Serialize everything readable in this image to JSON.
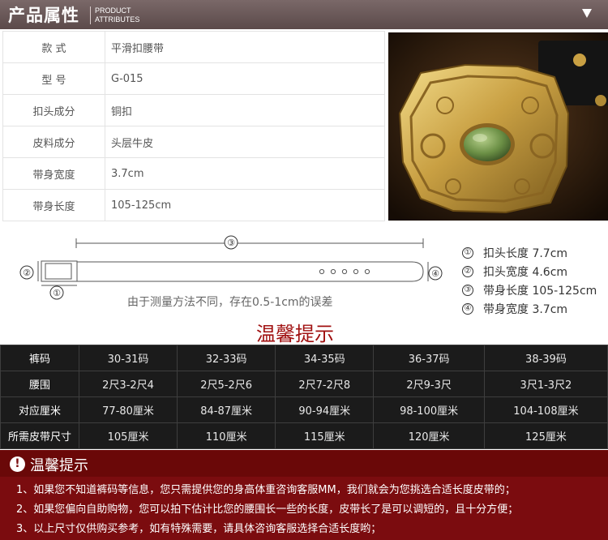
{
  "header": {
    "title": "产品属性",
    "subtitle_line1": "PRODUCT",
    "subtitle_line2": "ATTRIBUTES"
  },
  "attributes": [
    {
      "key": "款 式",
      "value": "平滑扣腰带"
    },
    {
      "key": "型 号",
      "value": "G-015"
    },
    {
      "key": "扣头成分",
      "value": "铜扣"
    },
    {
      "key": "皮料成分",
      "value": "头层牛皮"
    },
    {
      "key": "带身宽度",
      "value": "3.7cm"
    },
    {
      "key": "带身长度",
      "value": "105-125cm"
    }
  ],
  "diagram": {
    "markers": [
      "①",
      "②",
      "③",
      "④"
    ],
    "note": "由于测量方法不同，存在0.5-1cm的误差",
    "dimensions": [
      {
        "num": "①",
        "text": "扣头长度 7.7cm"
      },
      {
        "num": "②",
        "text": "扣头宽度 4.6cm"
      },
      {
        "num": "③",
        "text": "带身长度 105-125cm"
      },
      {
        "num": "④",
        "text": "带身宽度 3.7cm"
      }
    ]
  },
  "warm_title": "温馨提示",
  "size_table": {
    "rows": [
      {
        "label": "裤码",
        "cells": [
          "30-31码",
          "32-33码",
          "34-35码",
          "36-37码",
          "38-39码"
        ]
      },
      {
        "label": "腰围",
        "cells": [
          "2尺3-2尺4",
          "2尺5-2尺6",
          "2尺7-2尺8",
          "2尺9-3尺",
          "3尺1-3尺2"
        ]
      },
      {
        "label": "对应厘米",
        "cells": [
          "77-80厘米",
          "84-87厘米",
          "90-94厘米",
          "98-100厘米",
          "104-108厘米"
        ]
      },
      {
        "label": "所需皮带尺寸",
        "cells": [
          "105厘米",
          "110厘米",
          "115厘米",
          "120厘米",
          "125厘米"
        ]
      }
    ]
  },
  "notice": {
    "icon": "!",
    "title": "温馨提示",
    "items": [
      "1、如果您不知道裤码等信息，您只需提供您的身高体重咨询客服MM，我们就会为您挑选合适长度皮带的；",
      "2、如果您偏向自助购物，您可以拍下估计比您的腰围长一些的长度，皮带长了是可以调短的，且十分方便；",
      "3、以上尺寸仅供购买参考，如有特殊需要，请具体咨询客服选择合适长度哟；"
    ]
  },
  "colors": {
    "header_bg": "#6b5858",
    "warm_red": "#a01010",
    "notice_bg": "#7b0c0f",
    "table_dark": "#1b1b1b"
  }
}
